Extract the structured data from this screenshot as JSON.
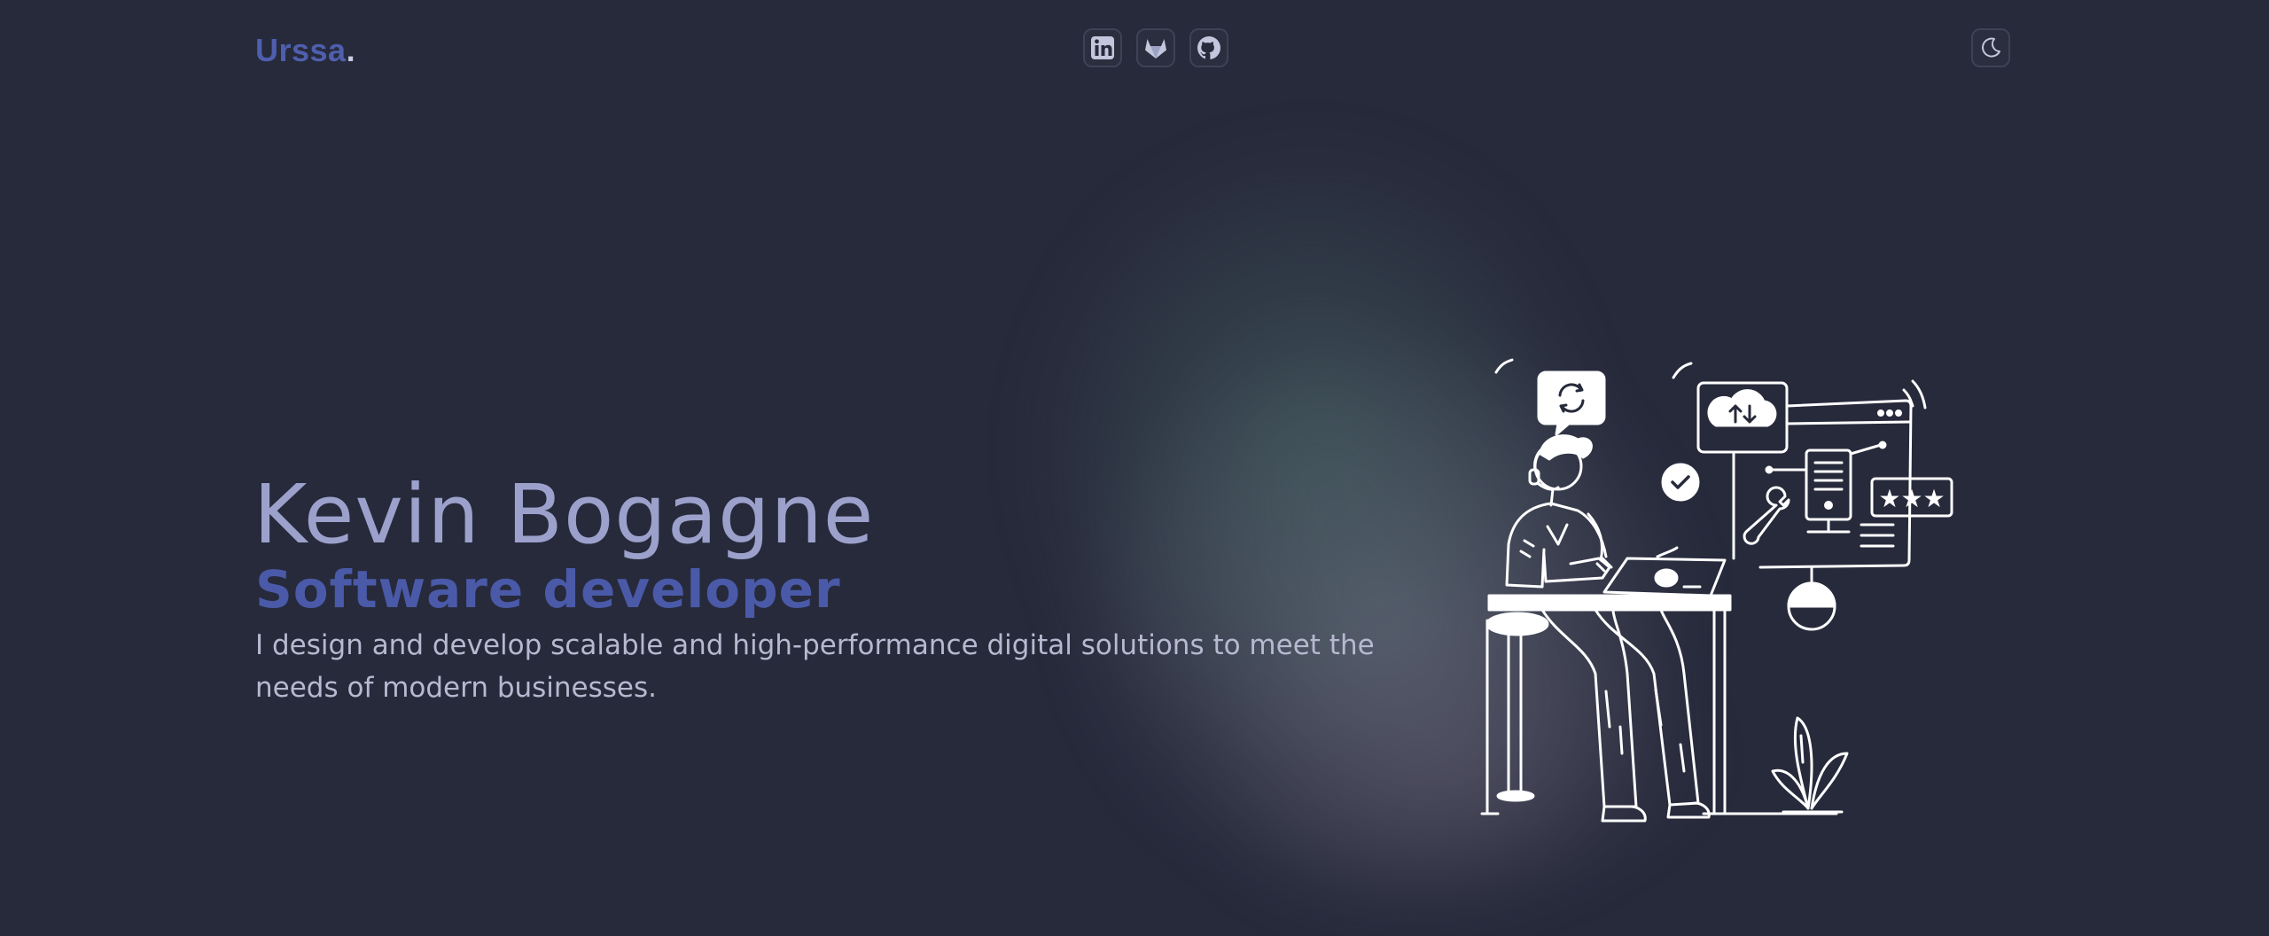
{
  "header": {
    "logo_text": "Urssa",
    "logo_dot": ".",
    "socials": [
      {
        "name": "linkedin",
        "icon": "linkedin-icon"
      },
      {
        "name": "gitlab",
        "icon": "gitlab-icon"
      },
      {
        "name": "github",
        "icon": "github-icon"
      }
    ],
    "theme_toggle_icon": "moon-icon"
  },
  "hero": {
    "name": "Kevin Bogagne",
    "role": "Software developer",
    "description": "I design and develop scalable and high-performance digital solutions to meet the needs of modern businesses."
  },
  "illustration": {
    "icon": "developer-at-laptop-illustration",
    "stars": "★★★"
  },
  "colors": {
    "background": "#272a3b",
    "accent": "#4f5fae",
    "name": "#9ca1cc",
    "text": "#b6b9d0",
    "border": "#3d4256"
  }
}
